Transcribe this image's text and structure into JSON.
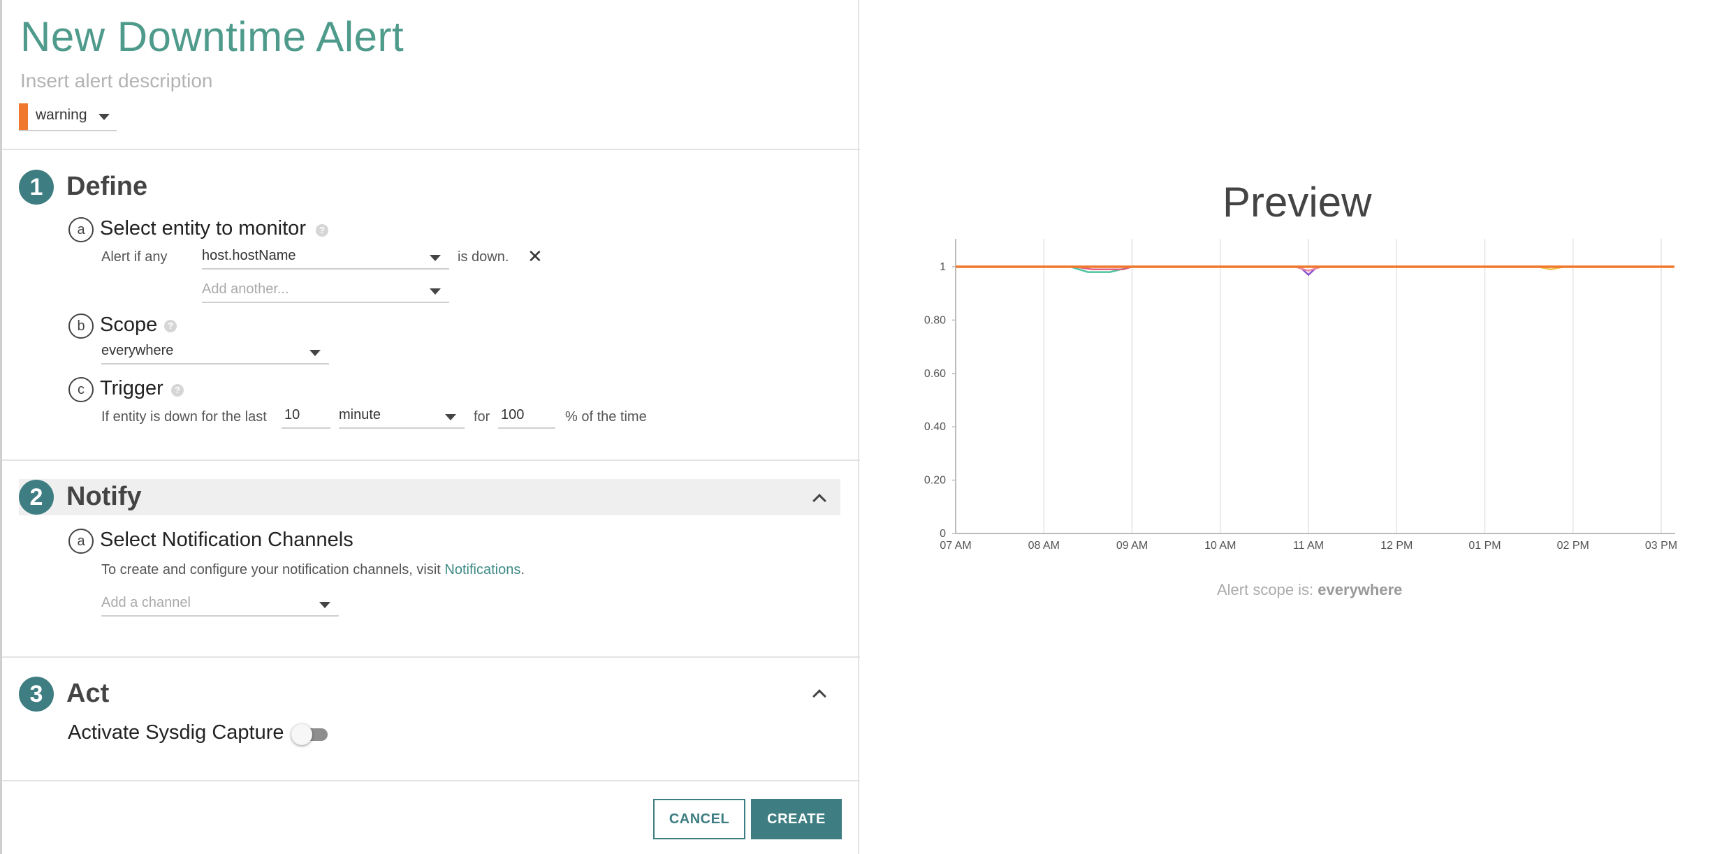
{
  "header": {
    "title": "New Downtime Alert",
    "description_placeholder": "Insert alert description",
    "severity": {
      "value": "warning",
      "color": "#f0782d"
    }
  },
  "define": {
    "number": "1",
    "title": "Define",
    "entity": {
      "letter": "a",
      "title": "Select entity to monitor",
      "alert_prefix": "Alert if any",
      "entity_value": "host.hostName",
      "suffix": "is down.",
      "add_another_placeholder": "Add another..."
    },
    "scope": {
      "letter": "b",
      "title": "Scope",
      "value": "everywhere"
    },
    "trigger": {
      "letter": "c",
      "title": "Trigger",
      "prefix": "If entity is down for the last",
      "duration": "10",
      "unit": "minute",
      "for_label": "for",
      "percent": "100",
      "suffix": "% of the time"
    }
  },
  "notify": {
    "number": "2",
    "title": "Notify",
    "channels": {
      "letter": "a",
      "title": "Select Notification Channels",
      "hint": "To create and configure your notification channels, visit",
      "link": "Notifications",
      "period": ".",
      "placeholder": "Add a channel"
    }
  },
  "act": {
    "number": "3",
    "title": "Act",
    "capture_label": "Activate Sysdig Capture",
    "capture_enabled": false
  },
  "footer": {
    "cancel_label": "CANCEL",
    "create_label": "CREATE"
  },
  "preview": {
    "title": "Preview",
    "scope_prefix": "Alert scope is:",
    "scope_value": "everywhere"
  },
  "colors": {
    "accent": "#3e7d81",
    "title": "#4e9a8b",
    "series_main": "#f0782d"
  },
  "chart_data": {
    "type": "line",
    "x_ticks": [
      "07 AM",
      "08 AM",
      "09 AM",
      "10 AM",
      "11 AM",
      "12 PM",
      "01 PM",
      "02 PM",
      "03 PM"
    ],
    "y_ticks": [
      "0",
      "0.20",
      "0.40",
      "0.60",
      "0.80",
      "1"
    ],
    "ylim": [
      0,
      1
    ],
    "grid": "vertical",
    "series": [
      {
        "color": "#f0782d",
        "x": [
          7.0,
          15.15
        ],
        "y": [
          1,
          1
        ]
      },
      {
        "color": "#4fc3a1",
        "x": [
          7.0,
          8.3,
          8.5,
          8.75,
          9.0,
          15.15
        ],
        "y": [
          1,
          1,
          0.98,
          0.98,
          1,
          1
        ]
      },
      {
        "color": "#e0607e",
        "x": [
          7.0,
          8.35,
          8.55,
          8.9,
          9.0,
          15.15
        ],
        "y": [
          1,
          1,
          0.99,
          0.99,
          1,
          1
        ]
      },
      {
        "color": "#8a4fd0",
        "x": [
          7.0,
          10.9,
          11.0,
          11.1,
          15.15
        ],
        "y": [
          1,
          1,
          0.97,
          1,
          1
        ]
      },
      {
        "color": "#e88aa8",
        "x": [
          7.0,
          10.85,
          11.0,
          11.15,
          15.15
        ],
        "y": [
          1,
          1,
          0.985,
          1,
          1
        ]
      },
      {
        "color": "#f2c14e",
        "x": [
          7.0,
          13.6,
          13.75,
          13.9,
          15.15
        ],
        "y": [
          1,
          1,
          0.99,
          1,
          1
        ]
      }
    ]
  }
}
